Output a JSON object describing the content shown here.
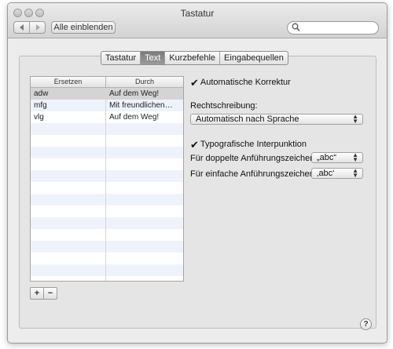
{
  "window": {
    "title": "Tastatur"
  },
  "toolbar": {
    "show_all_label": "Alle einblenden",
    "search_placeholder": ""
  },
  "tabs": [
    {
      "label": "Tastatur"
    },
    {
      "label": "Text"
    },
    {
      "label": "Kurzbefehle"
    },
    {
      "label": "Eingabequellen"
    }
  ],
  "replacements": {
    "col_replace": "Ersetzen",
    "col_with": "Durch",
    "rows": [
      {
        "replace": "adw",
        "with": "Auf dem Weg!"
      },
      {
        "replace": "mfg",
        "with": "Mit freundlichen…"
      },
      {
        "replace": "vlg",
        "with": "Auf dem Weg!"
      }
    ],
    "add_label": "+",
    "remove_label": "−"
  },
  "options": {
    "auto_correct": {
      "label": "Automatische Korrektur",
      "checked": true
    },
    "spelling": {
      "label": "Rechtschreibung:",
      "value": "Automatisch nach Sprache"
    },
    "smart_quotes": {
      "label": "Typografische Interpunktion",
      "checked": true
    },
    "double_quotes": {
      "label": "Für doppelte Anführungszeichen",
      "value": "„abc“"
    },
    "single_quotes": {
      "label": "Für einfache Anführungszeichen",
      "value": "‚abc‘"
    }
  },
  "help_label": "?",
  "icons": {
    "check": "✔",
    "popup_arrows_up": "▲",
    "popup_arrows_down": "▼"
  }
}
